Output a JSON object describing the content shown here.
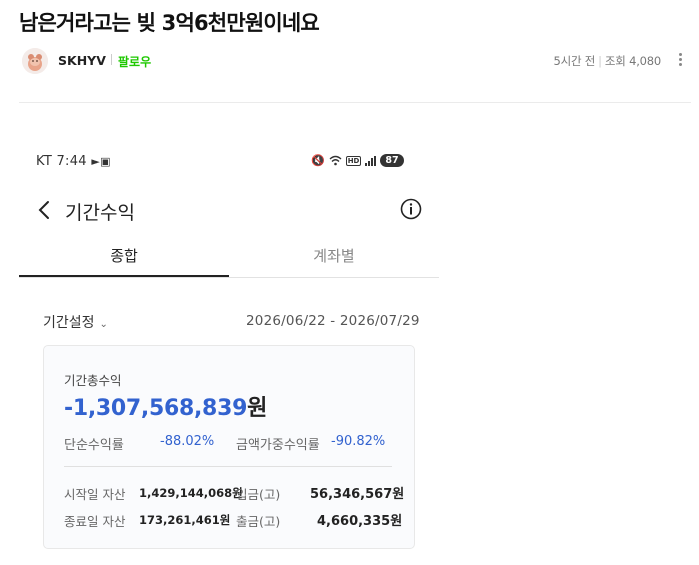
{
  "post": {
    "title": "남은거라고는 빚 3억6천만원이네요",
    "author": "SKHYV",
    "follow_label": "팔로우",
    "time_ago": "5시간 전",
    "views_label": "조회 4,080"
  },
  "phone": {
    "status_left": "KT 7:44",
    "battery": "87",
    "hd": "HD",
    "screen_title": "기간수익",
    "tabs": [
      {
        "label": "종합",
        "active": true
      },
      {
        "label": "계좌별",
        "active": false
      }
    ],
    "period_label": "기간설정",
    "period_range": "2026/06/22 - 2026/07/29",
    "card": {
      "total_label": "기간총수익",
      "total_value": "-1,307,568,839",
      "total_unit": "원",
      "simple_return_label": "단순수익률",
      "simple_return_value": "-88.02%",
      "weighted_return_label": "금액가중수익률",
      "weighted_return_value": "-90.82%",
      "start_assets_label": "시작일 자산",
      "start_assets_value": "1,429,144,068원",
      "deposit_label": "입금(고)",
      "deposit_value": "56,346,567원",
      "end_assets_label": "종료일 자산",
      "end_assets_value": "173,261,461원",
      "withdraw_label": "출금(고)",
      "withdraw_value": "4,660,335원"
    }
  },
  "colors": {
    "accent_blue": "#3262cf",
    "follow_green": "#1ec800"
  }
}
